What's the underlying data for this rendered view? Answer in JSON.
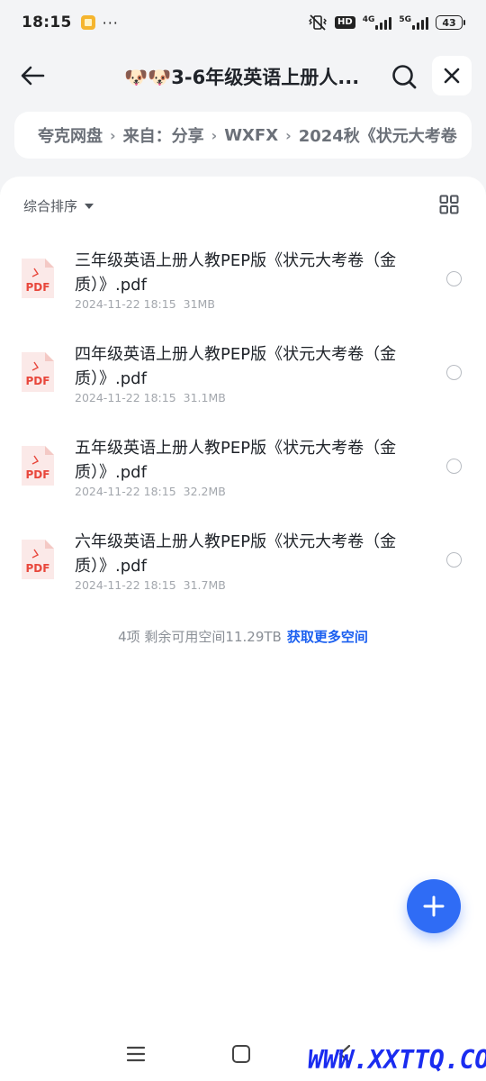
{
  "status_bar": {
    "time": "18:15",
    "dots": "···",
    "hd_label": "HD",
    "net1_label": "4G",
    "net2_label": "5G",
    "battery": "43"
  },
  "header": {
    "title": "🐶🐶3-6年级英语上册人..."
  },
  "breadcrumb": {
    "items": [
      "夸克网盘",
      "来自：分享",
      "WXFX",
      "2024秋《状元大考卷"
    ]
  },
  "toolbar": {
    "sort_label": "综合排序"
  },
  "files": [
    {
      "name": "三年级英语上册人教PEP版《状元大考卷（金质）》.pdf",
      "date": "2024-11-22 18:15",
      "size": "31MB",
      "icon_label": "PDF"
    },
    {
      "name": "四年级英语上册人教PEP版《状元大考卷（金质）》.pdf",
      "date": "2024-11-22 18:15",
      "size": "31.1MB",
      "icon_label": "PDF"
    },
    {
      "name": "五年级英语上册人教PEP版《状元大考卷（金质）》.pdf",
      "date": "2024-11-22 18:15",
      "size": "32.2MB",
      "icon_label": "PDF"
    },
    {
      "name": "六年级英语上册人教PEP版《状元大考卷（金质）》.pdf",
      "date": "2024-11-22 18:15",
      "size": "31.7MB",
      "icon_label": "PDF"
    }
  ],
  "footer": {
    "summary": "4项 剩余可用空间11.29TB",
    "more_space_link": "获取更多空间"
  },
  "watermark": "WWW.XXTTQ.COM",
  "colors": {
    "accent": "#2f6cf5",
    "link": "#1a5ff0",
    "pdf_red": "#e8473c"
  }
}
